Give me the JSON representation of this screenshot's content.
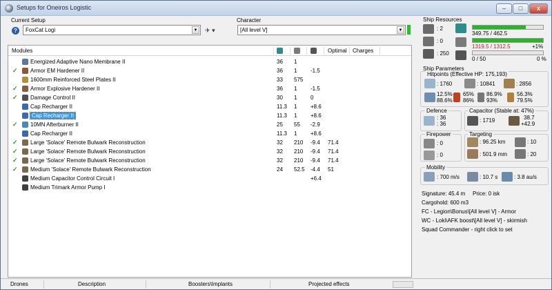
{
  "window": {
    "title": "Setups for Oneiros Logistic",
    "buttons": {
      "minimize": "–",
      "maximize": "□",
      "close": "x"
    }
  },
  "setup": {
    "label": "Current Setup",
    "value": "FoxCat Logi"
  },
  "character": {
    "label": "Character",
    "value": "[All level V]"
  },
  "list": {
    "headers": {
      "modules": "Modules",
      "optimal": "Optimal",
      "charges": "Charges"
    },
    "rows": [
      {
        "checked": false,
        "name": "Energized Adaptive Nano Membrane II",
        "c1": "36",
        "c2": "1",
        "c3": "",
        "c4": "",
        "selected": false,
        "icon": "#5b7aa0"
      },
      {
        "checked": true,
        "name": "Armor EM Hardener II",
        "c1": "36",
        "c2": "1",
        "c3": "-1.5",
        "c4": "",
        "selected": false,
        "icon": "#8a5a3a"
      },
      {
        "checked": false,
        "name": "1600mm Reinforced Steel Plates II",
        "c1": "33",
        "c2": "575",
        "c3": "",
        "c4": "",
        "selected": false,
        "icon": "#b09040"
      },
      {
        "checked": true,
        "name": "Armor Explosive Hardener II",
        "c1": "36",
        "c2": "1",
        "c3": "-1.5",
        "c4": "",
        "selected": false,
        "icon": "#8a5a3a"
      },
      {
        "checked": true,
        "name": "Damage Control II",
        "c1": "30",
        "c2": "1",
        "c3": "0",
        "c4": "",
        "selected": false,
        "icon": "#505050"
      },
      {
        "checked": false,
        "name": "Cap Recharger II",
        "c1": "11.3",
        "c2": "1",
        "c3": "+8.6",
        "c4": "",
        "selected": false,
        "icon": "#3a6ab0"
      },
      {
        "checked": false,
        "name": "Cap Recharger II",
        "c1": "11.3",
        "c2": "1",
        "c3": "+8.6",
        "c4": "",
        "selected": true,
        "icon": "#3a6ab0"
      },
      {
        "checked": true,
        "name": "10MN Afterburner II",
        "c1": "25",
        "c2": "55",
        "c3": "-2.9",
        "c4": "",
        "selected": false,
        "icon": "#4a8ab0"
      },
      {
        "checked": false,
        "name": "Cap Recharger II",
        "c1": "11.3",
        "c2": "1",
        "c3": "+8.6",
        "c4": "",
        "selected": false,
        "icon": "#3a6ab0"
      },
      {
        "checked": true,
        "name": "Large 'Solace' Remote Bulwark Reconstruction",
        "c1": "32",
        "c2": "210",
        "c3": "-9.4",
        "c4": "71.4",
        "selected": false,
        "icon": "#7a6a50"
      },
      {
        "checked": true,
        "name": "Large 'Solace' Remote Bulwark Reconstruction",
        "c1": "32",
        "c2": "210",
        "c3": "-9.4",
        "c4": "71.4",
        "selected": false,
        "icon": "#7a6a50"
      },
      {
        "checked": true,
        "name": "Large 'Solace' Remote Bulwark Reconstruction",
        "c1": "32",
        "c2": "210",
        "c3": "-9.4",
        "c4": "71.4",
        "selected": false,
        "icon": "#7a6a50"
      },
      {
        "checked": true,
        "name": "Medium 'Solace' Remote Bulwark Reconstruction",
        "c1": "24",
        "c2": "52.5",
        "c3": "-4.4",
        "c4": "51",
        "selected": false,
        "icon": "#7a6a50"
      },
      {
        "checked": false,
        "name": "Medium Capacitor Control Circuit I",
        "c1": "",
        "c2": "",
        "c3": "+6.4",
        "c4": "",
        "selected": false,
        "icon": "#404040"
      },
      {
        "checked": false,
        "name": "Medium Trimark Armor Pump I",
        "c1": "",
        "c2": "",
        "c3": "",
        "c4": "",
        "selected": false,
        "icon": "#404040"
      }
    ]
  },
  "statusbar": {
    "drones": "Drones",
    "description": "Description",
    "boosters": "Boosters\\Implants",
    "projected": "Projected effects"
  },
  "resources": {
    "title": "Ship Resources",
    "turrets": "2",
    "launchers": "0",
    "calibration": "250",
    "cpu": "349.75 / 462.5",
    "cpu_fraction": 0.756,
    "power": "1319.5 / 1312.5",
    "power_pct": "+1%",
    "power_fraction": 1.0,
    "drone_bay": "0 / 50",
    "drone_pct": "0 %",
    "drone_fraction": 0
  },
  "params": {
    "title": "Ship Parameters",
    "hitpoints_title": "Hitpoints (Effective HP: 175,193)",
    "hp_shield": ": 1760",
    "hp_armor": ": 10841",
    "hp_structure": ": 2856",
    "res": {
      "shield_em": "12.5%",
      "shield_th": "65%",
      "shield_kin": "86.9%",
      "shield_ex": "56.3%",
      "armor_em": "88.6%",
      "armor_th": "86%",
      "armor_kin": "93%",
      "armor_ex": "79.5%"
    },
    "defence_title": "Defence",
    "defence_a": "36",
    "defence_b": "36",
    "capacitor_title": "Capacitor (Stable at: 47%)",
    "cap_amount": ": 1719",
    "cap_delta_a": "38.7",
    "cap_delta_b": "+42.9",
    "firepower_title": "Firepower",
    "fp_a": ": 0",
    "fp_b": ": 0",
    "targeting_title": "Targeting",
    "tg_range": ": 96.25 km",
    "tg_targets": ": 10",
    "tg_scan": ": 501.9 mm",
    "tg_sensor": ": 20",
    "mobility_title": "Mobility",
    "mob_speed": ": 700 m/s",
    "mob_align": ": 10.7 s",
    "mob_warp": ": 3.8 au/s"
  },
  "info": {
    "signature": "Signature: 45.4 m",
    "price": "Price: 0 isk",
    "cargohold": "Cargohold: 600 m3",
    "fc": "FC - Legion\\Bonus\\[All level V] - Armor",
    "wc": "WC - Loki\\AFK boost\\[All level V] - skirmish",
    "squad": "Squad Commander - right click to set"
  },
  "colors": {
    "check": "#2a9a2a",
    "selected": "#3399ff",
    "cpu_bar": "#25b825",
    "power_bar": "#d03030"
  }
}
